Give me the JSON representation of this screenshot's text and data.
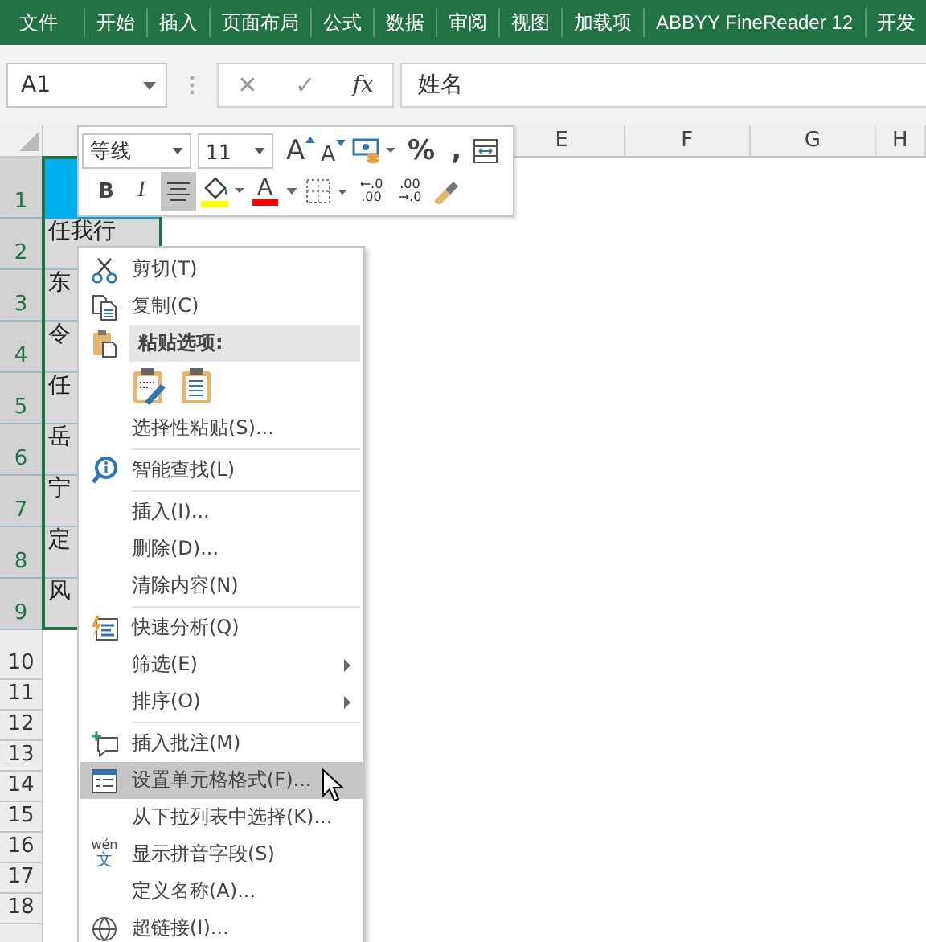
{
  "ribbon_tabs": [
    {
      "label": "文件"
    },
    {
      "label": "开始"
    },
    {
      "label": "插入"
    },
    {
      "label": "页面布局"
    },
    {
      "label": "公式"
    },
    {
      "label": "数据"
    },
    {
      "label": "审阅"
    },
    {
      "label": "视图"
    },
    {
      "label": "加载项"
    },
    {
      "label": "ABBYY FineReader 12"
    },
    {
      "label": "开发"
    }
  ],
  "name_box": {
    "value": "A1"
  },
  "formula_buttons": {
    "cancel": "✕",
    "enter": "✓",
    "function": "fx"
  },
  "formula_bar": {
    "value": "姓名"
  },
  "column_headers": [
    {
      "label": "E",
      "selected": false
    },
    {
      "label": "F",
      "selected": false
    },
    {
      "label": "G",
      "selected": false
    },
    {
      "label": "H",
      "selected": false
    }
  ],
  "rows": [
    {
      "header": "1",
      "selected": true,
      "color": "#00b0f0"
    },
    {
      "header": "2",
      "selected": true,
      "cell": "任我行"
    },
    {
      "header": "3",
      "selected": true,
      "cell": "东"
    },
    {
      "header": "4",
      "selected": true,
      "cell": "令"
    },
    {
      "header": "5",
      "selected": true,
      "cell": "任"
    },
    {
      "header": "6",
      "selected": true,
      "cell": "岳"
    },
    {
      "header": "7",
      "selected": true,
      "cell": "宁"
    },
    {
      "header": "8",
      "selected": true,
      "cell": "定"
    },
    {
      "header": "9",
      "selected": true,
      "cell": "风"
    },
    {
      "header": "10",
      "selected": false
    },
    {
      "header": "11",
      "selected": false
    },
    {
      "header": "12",
      "selected": false
    },
    {
      "header": "13",
      "selected": false
    },
    {
      "header": "14",
      "selected": false
    },
    {
      "header": "15",
      "selected": false
    },
    {
      "header": "16",
      "selected": false
    },
    {
      "header": "17",
      "selected": false
    },
    {
      "header": "18",
      "selected": false
    }
  ],
  "mini_toolbar": {
    "font": "等线",
    "size": "11",
    "row1": [
      {
        "kind": "grow",
        "label": "A"
      },
      {
        "kind": "shrink",
        "label": "A"
      },
      {
        "kind": "accounting"
      },
      {
        "kind": "percent",
        "label": "%"
      },
      {
        "kind": "comma",
        "label": ","
      },
      {
        "kind": "wrap"
      }
    ],
    "row2": [
      {
        "kind": "bold",
        "label": "B",
        "selected": false
      },
      {
        "kind": "italic",
        "label": "I",
        "selected": false
      },
      {
        "kind": "align",
        "selected": true
      },
      {
        "kind": "fill",
        "color": "#ffff00"
      },
      {
        "kind": "fontcolor",
        "label": "A",
        "color": "#ff0000"
      },
      {
        "kind": "borders"
      },
      {
        "kind": "decimal",
        "top": "←.0",
        "bottom": ".00"
      },
      {
        "kind": "decimal",
        "top": ".00",
        "bottom": "→.0"
      },
      {
        "kind": "painter"
      }
    ]
  },
  "context_menu": {
    "items": [
      {
        "kind": "item",
        "label": "剪切(T)",
        "selected": false,
        "submenu": false
      },
      {
        "kind": "item",
        "label": "复制(C)",
        "selected": false,
        "submenu": false
      },
      {
        "kind": "header",
        "label": "粘贴选项:"
      },
      {
        "kind": "paste_icons"
      },
      {
        "kind": "item",
        "label": "选择性粘贴(S)...",
        "selected": false,
        "submenu": false
      },
      {
        "kind": "separator"
      },
      {
        "kind": "item",
        "label": "智能查找(L)",
        "selected": false,
        "submenu": false
      },
      {
        "kind": "separator"
      },
      {
        "kind": "item",
        "label": "插入(I)...",
        "selected": false,
        "submenu": false
      },
      {
        "kind": "item",
        "label": "删除(D)...",
        "selected": false,
        "submenu": false
      },
      {
        "kind": "item",
        "label": "清除内容(N)",
        "selected": false,
        "submenu": false
      },
      {
        "kind": "separator"
      },
      {
        "kind": "item",
        "label": "快速分析(Q)",
        "selected": false,
        "submenu": false
      },
      {
        "kind": "item",
        "label": "筛选(E)",
        "selected": false,
        "submenu": true
      },
      {
        "kind": "item",
        "label": "排序(O)",
        "selected": false,
        "submenu": true
      },
      {
        "kind": "separator"
      },
      {
        "kind": "item",
        "label": "插入批注(M)",
        "selected": false,
        "submenu": false
      },
      {
        "kind": "item",
        "label": "设置单元格格式(F)...",
        "selected": true,
        "submenu": false
      },
      {
        "kind": "item",
        "label": "从下拉列表中选择(K)...",
        "selected": false,
        "submenu": false
      },
      {
        "kind": "item",
        "label": "显示拼音字段(S)",
        "selected": false,
        "submenu": false,
        "icon_text": [
          "wén",
          "文"
        ]
      },
      {
        "kind": "item",
        "label": "定义名称(A)...",
        "selected": false,
        "submenu": false
      },
      {
        "kind": "item",
        "label": "超链接(I)...",
        "selected": false,
        "submenu": false
      }
    ]
  }
}
